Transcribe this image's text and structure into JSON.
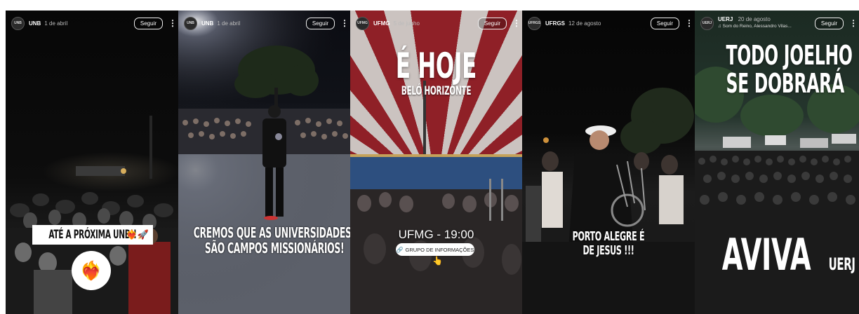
{
  "follow_label": "Seguir",
  "stories": [
    {
      "username": "UNB",
      "date": "1 de abril",
      "avatar_text": "UNB",
      "caption": "ATÉ A PRÓXIMA UNB!! ❤️‍🔥🚀",
      "caption_text": "ATÉ A PRÓXIMA UNB!!",
      "sticker_emoji": "❤️‍🔥"
    },
    {
      "username": "UNB",
      "date": "1 de abril",
      "avatar_text": "UNB",
      "caption_line1": "CREMOS QUE AS UNIVERSIDADES",
      "caption_line2": "SÃO CAMPOS MISSIONÁRIOS!",
      "caption_emoji": "❤️‍🔥"
    },
    {
      "username": "UFMG",
      "date": "5 de junho",
      "avatar_text": "UFMG",
      "headline": "É HOJE",
      "subheadline": "BELÓ HORIZONTE",
      "time_text": "UFMG - 19:00",
      "link_text": "GRUPO DE INFORMAÇÕES"
    },
    {
      "username": "UFRGS",
      "date": "12 de agosto",
      "avatar_text": "UFRGS",
      "caption_line1": "PORTO ALEGRE É",
      "caption_line2": "DE JESUS !!!"
    },
    {
      "username": "UERJ",
      "date": "20 de agosto",
      "avatar_text": "UERJ",
      "music": "♫ Som do Reino, Alessandro Vilas...",
      "headline_line1": "TODO JOELHO",
      "headline_line2": "SE DOBRARÁ",
      "footer_big": "AVIVA",
      "footer_small": "UERJ"
    }
  ]
}
